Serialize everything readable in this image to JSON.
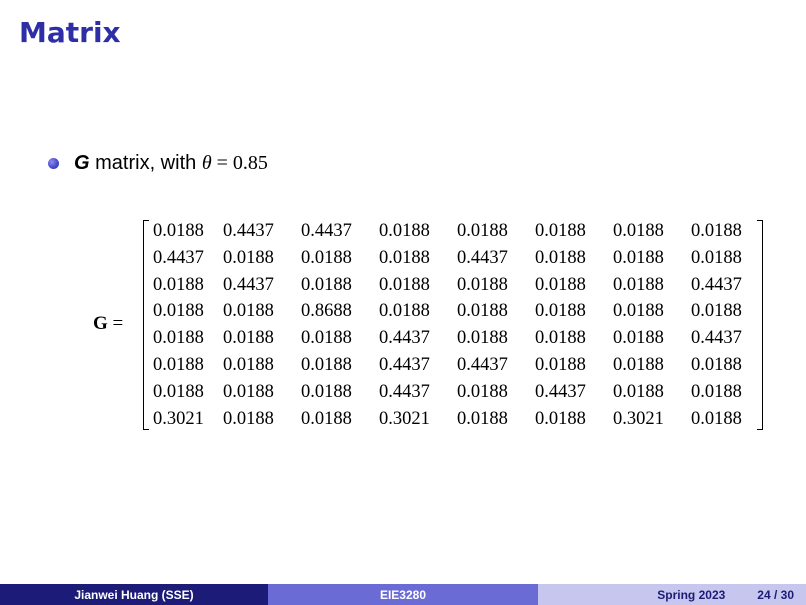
{
  "slide": {
    "title": "Matrix"
  },
  "bullet": {
    "symbol": "G",
    "text": " matrix, with ",
    "theta": "θ",
    "equals_value": " = 0.85"
  },
  "equation": {
    "lhs": "G",
    "eq": " ="
  },
  "matrix": {
    "rows": [
      [
        "0.0188",
        "0.4437",
        "0.4437",
        "0.0188",
        "0.0188",
        "0.0188",
        "0.0188",
        "0.0188"
      ],
      [
        "0.4437",
        "0.0188",
        "0.0188",
        "0.0188",
        "0.4437",
        "0.0188",
        "0.0188",
        "0.0188"
      ],
      [
        "0.0188",
        "0.4437",
        "0.0188",
        "0.0188",
        "0.0188",
        "0.0188",
        "0.0188",
        "0.4437"
      ],
      [
        "0.0188",
        "0.0188",
        "0.8688",
        "0.0188",
        "0.0188",
        "0.0188",
        "0.0188",
        "0.0188"
      ],
      [
        "0.0188",
        "0.0188",
        "0.0188",
        "0.4437",
        "0.0188",
        "0.0188",
        "0.0188",
        "0.4437"
      ],
      [
        "0.0188",
        "0.0188",
        "0.0188",
        "0.4437",
        "0.4437",
        "0.0188",
        "0.0188",
        "0.0188"
      ],
      [
        "0.0188",
        "0.0188",
        "0.0188",
        "0.4437",
        "0.0188",
        "0.4437",
        "0.0188",
        "0.0188"
      ],
      [
        "0.3021",
        "0.0188",
        "0.0188",
        "0.3021",
        "0.0188",
        "0.0188",
        "0.3021",
        "0.0188"
      ]
    ]
  },
  "footer": {
    "author": "Jianwei Huang  (SSE)",
    "course": "EIE3280",
    "date": "Spring 2023",
    "page": "24 / 30"
  },
  "colors": {
    "title": "#2e2ea6",
    "footer_dark": "#1c1c78",
    "footer_mid": "#6b6bd6",
    "footer_light": "#c6c6ee"
  }
}
